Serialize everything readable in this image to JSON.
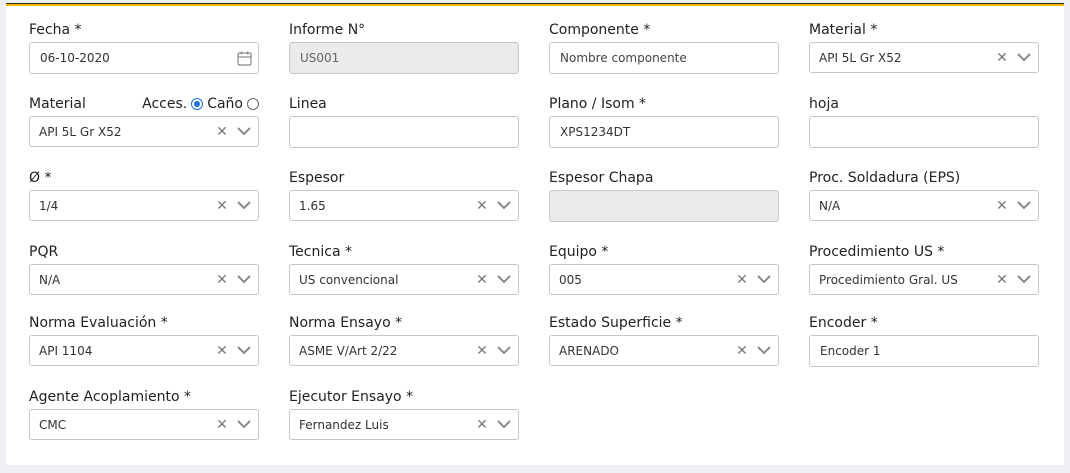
{
  "form": {
    "fecha": {
      "label": "Fecha *",
      "value": "06-10-2020"
    },
    "informe": {
      "label": "Informe N°",
      "value": "US001"
    },
    "componente": {
      "label": "Componente *",
      "placeholder": "Nombre componente"
    },
    "material_top": {
      "label": "Material *",
      "value": "API 5L Gr X52"
    },
    "material": {
      "label": "Material",
      "value": "API 5L Gr X52",
      "opt_acces": "Acces.",
      "opt_cano": "Caño",
      "selected": "Acces."
    },
    "linea": {
      "label": "Linea",
      "value": ""
    },
    "plano": {
      "label": "Plano / Isom *",
      "value": "XPS1234DT"
    },
    "hoja": {
      "label": "hoja",
      "value": ""
    },
    "diametro": {
      "label": "Ø *",
      "value": "1/4"
    },
    "espesor": {
      "label": "Espesor",
      "value": "1.65"
    },
    "espesor_chapa": {
      "label": "Espesor Chapa",
      "value": ""
    },
    "proc_soldadura": {
      "label": "Proc. Soldadura (EPS)",
      "value": "N/A"
    },
    "pqr": {
      "label": "PQR",
      "value": "N/A"
    },
    "tecnica": {
      "label": "Tecnica *",
      "value": "US convencional"
    },
    "equipo": {
      "label": "Equipo *",
      "value": "005"
    },
    "procedimiento": {
      "label": "Procedimiento US *",
      "value": "Procedimiento Gral. US"
    },
    "norma_eval": {
      "label": "Norma Evaluación *",
      "value": "API 1104"
    },
    "norma_ensayo": {
      "label": "Norma Ensayo *",
      "value": "ASME V/Art 2/22"
    },
    "estado_superficie": {
      "label": "Estado Superficie *",
      "value": "ARENADO"
    },
    "encoder": {
      "label": "Encoder *",
      "value": "Encoder 1"
    },
    "agente": {
      "label": "Agente Acoplamiento *",
      "value": "CMC"
    },
    "ejecutor": {
      "label": "Ejecutor Ensayo *",
      "value": "Fernandez Luis"
    }
  },
  "icons": {
    "clear": "clear-icon",
    "chevron": "chevron-down-icon",
    "calendar": "calendar-icon"
  },
  "colors": {
    "accent_top": "#f2b705",
    "radio_checked": "#1a73e8"
  }
}
